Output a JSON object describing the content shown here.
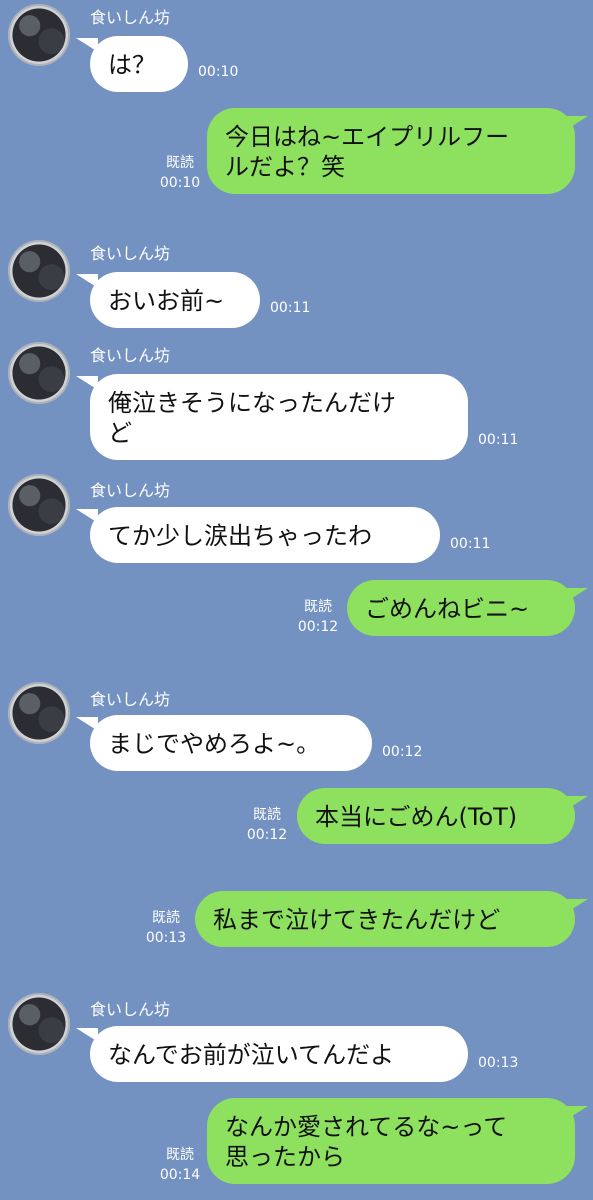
{
  "contact": {
    "name": "食いしん坊"
  },
  "messages": [
    {
      "text": "は？",
      "time": "00:10"
    },
    {
      "text": "今日はね~エイプリルフー\nルだよ？笑",
      "read": "既読",
      "time": "00:10"
    },
    {
      "text": "おいお前~",
      "time": "00:11"
    },
    {
      "text": "俺泣きそうになったんだけ\nど",
      "time": "00:11"
    },
    {
      "text": "てか少し涙出ちゃったわ",
      "time": "00:11"
    },
    {
      "text": "ごめんねビニ~",
      "read": "既読",
      "time": "00:12"
    },
    {
      "text": "まじでやめろよ~。",
      "time": "00:12"
    },
    {
      "text": "本当にごめん(ToT)",
      "read": "既読",
      "time": "00:12"
    },
    {
      "text": "私まで泣けてきたんだけど",
      "read": "既読",
      "time": "00:13"
    },
    {
      "text": "なんでお前が泣いてんだよ",
      "time": "00:13"
    },
    {
      "text": "なんか愛されてるな~って\n思ったから",
      "read": "既読",
      "time": "00:14"
    }
  ]
}
